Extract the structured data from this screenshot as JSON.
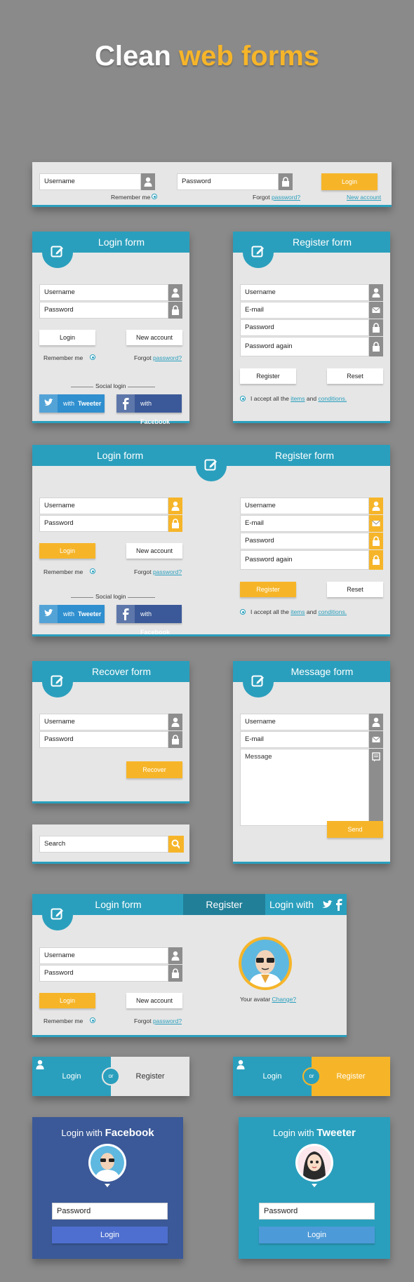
{
  "page": {
    "title_main": "Clean",
    "title_accent": "web forms"
  },
  "colors": {
    "accent": "#2a9fbd",
    "yellow": "#f6b529",
    "facebook": "#3b5998",
    "twitter": "#2f8fcf",
    "background": "#8a8a8a"
  },
  "topbar": {
    "username": "Username",
    "password": "Password",
    "login": "Login",
    "remember": "Remember me",
    "forgot": "Forgot",
    "forgot_link": "password?",
    "new_account": "New account"
  },
  "login1": {
    "title": "Login form",
    "username": "Username",
    "password": "Password",
    "login": "Login",
    "new_account": "New account",
    "remember": "Remember me",
    "forgot": "Forgot",
    "forgot_link": "password?",
    "social": "Social login",
    "tw_with": "with",
    "tw_name": "Tweeter",
    "fb_with": "with",
    "fb_name": "Facebook"
  },
  "register1": {
    "title": "Register form",
    "username": "Username",
    "email": "E-mail",
    "password": "Password",
    "password_again": "Password again",
    "register": "Register",
    "reset": "Reset",
    "accept": "I accept all the",
    "items": "items",
    "and": "and",
    "conditions": "conditions."
  },
  "combo": {
    "login_title": "Login form",
    "register_title": "Register form",
    "username": "Username",
    "password": "Password",
    "login": "Login",
    "new_account": "New account",
    "remember": "Remember me",
    "forgot": "Forgot",
    "forgot_link": "password?",
    "social": "Social login",
    "tw_with": "with",
    "tw_name": "Tweeter",
    "fb_with": "with",
    "fb_name": "Facebook",
    "r_username": "Username",
    "r_email": "E-mail",
    "r_password": "Password",
    "r_password_again": "Password again",
    "register": "Register",
    "reset": "Reset",
    "accept": "I accept all the",
    "items": "items",
    "and": "and",
    "conditions": "conditions."
  },
  "recover": {
    "title": "Recover form",
    "username": "Username",
    "password": "Password",
    "button": "Recover"
  },
  "search": {
    "placeholder": "Search"
  },
  "message": {
    "title": "Message form",
    "username": "Username",
    "email": "E-mail",
    "message": "Message",
    "send": "Send"
  },
  "tabbed": {
    "tab_login": "Login form",
    "tab_register": "Register",
    "tab_login_with": "Login with",
    "username": "Username",
    "password": "Password",
    "login": "Login",
    "new_account": "New account",
    "remember": "Remember me",
    "forgot": "Forgot",
    "forgot_link": "password?",
    "avatar_text": "Your avatar",
    "avatar_link": "Change?"
  },
  "toggle1": {
    "login": "Login",
    "or": "or",
    "register": "Register"
  },
  "toggle2": {
    "login": "Login",
    "or": "or",
    "register": "Register"
  },
  "fbcard": {
    "prefix": "Login with",
    "brand": "Facebook",
    "password": "Password",
    "login": "Login"
  },
  "twcard": {
    "prefix": "Login with",
    "brand": "Tweeter",
    "password": "Password",
    "login": "Login"
  }
}
